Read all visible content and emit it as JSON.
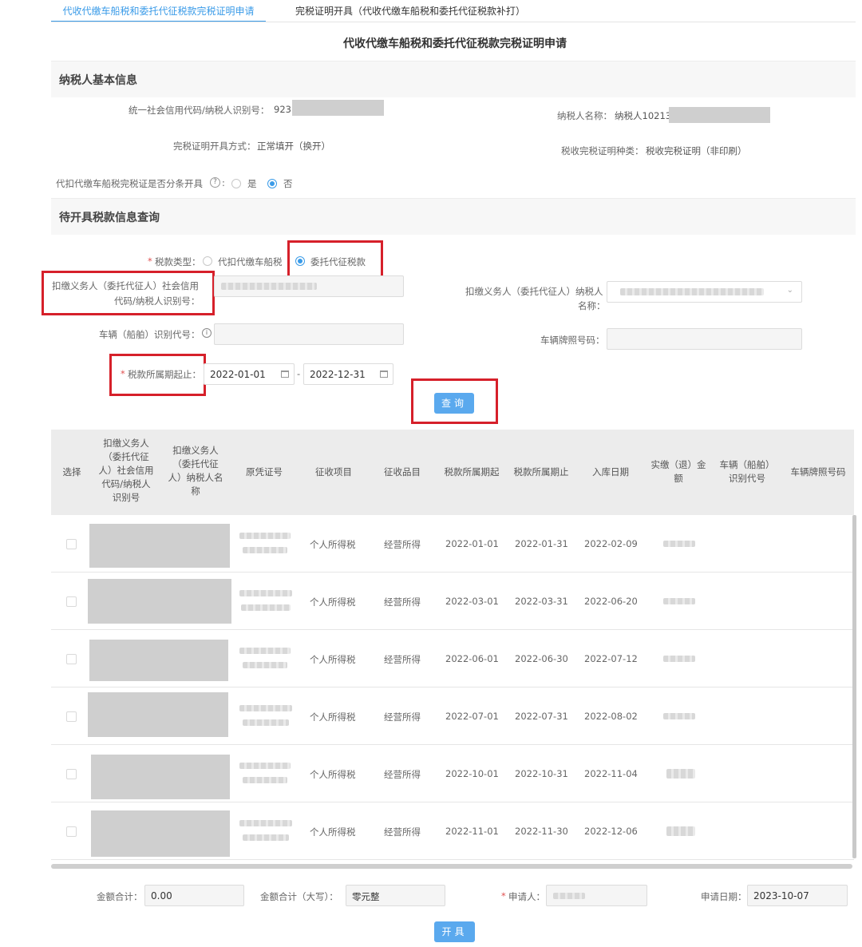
{
  "tabs": [
    {
      "label": "代收代缴车船税和委托代征税款完税证明申请"
    },
    {
      "label": "完税证明开具（代收代缴车船税和委托代征税款补打）"
    }
  ],
  "page_title": "代收代缴车船税和委托代征税款完税证明申请",
  "taxpayer_section": {
    "title": "纳税人基本信息",
    "credit_code_label": "统一社会信用代码/纳税人识别号：",
    "credit_code_value": "923",
    "name_label": "纳税人名称：",
    "name_value": "纳税人10213",
    "issue_method_label": "完税证明开具方式：",
    "issue_method_value": "正常填开（换开）",
    "cert_type_label": "税收完税证明种类：",
    "cert_type_value": "税收完税证明（非印刷）",
    "split_label": "代扣代缴车船税完税证是否分条开具",
    "split_help": "?",
    "split_yes": "是",
    "split_no": "否"
  },
  "query_section": {
    "title": "待开具税款信息查询",
    "tax_type_label": "税款类型：",
    "tax_type_option1": "代扣代缴车船税",
    "tax_type_option2": "委托代征税款",
    "withholder_code_label_line1": "扣缴义务人（委托代征人）社会信用",
    "withholder_code_label_line2": "代码/纳税人识别号：",
    "withholder_name_label_line1": "扣缴义务人（委托代征人）纳税人",
    "withholder_name_label_line2": "名称：",
    "vehicle_id_label": "车辆（船舶）识别代号：",
    "vehicle_id_info": "i",
    "plate_label": "车辆牌照号码：",
    "period_label": "税款所属期起止：",
    "period_start": "2022-01-01",
    "period_end": "2022-12-31",
    "period_sep": "-",
    "query_button": "查询"
  },
  "table": {
    "headers": [
      {
        "label": "选择"
      },
      {
        "label": "扣缴义务人（委托代征人）社会信用代码/纳税人识别号"
      },
      {
        "label": "扣缴义务人（委托代征人）纳税人名称"
      },
      {
        "label": "原凭证号"
      },
      {
        "label": "征收项目"
      },
      {
        "label": "征收品目"
      },
      {
        "label": "税款所属期起"
      },
      {
        "label": "税款所属期止"
      },
      {
        "label": "入库日期"
      },
      {
        "label": "实缴（退）金额"
      },
      {
        "label": "车辆（船舶）识别代号"
      },
      {
        "label": "车辆牌照号码"
      }
    ],
    "rows": [
      {
        "item": "个人所得税",
        "category": "经营所得",
        "start": "2022-01-01",
        "end": "2022-01-31",
        "date": "2022-02-09"
      },
      {
        "item": "个人所得税",
        "category": "经营所得",
        "start": "2022-03-01",
        "end": "2022-03-31",
        "date": "2022-06-20"
      },
      {
        "item": "个人所得税",
        "category": "经营所得",
        "start": "2022-06-01",
        "end": "2022-06-30",
        "date": "2022-07-12"
      },
      {
        "item": "个人所得税",
        "category": "经营所得",
        "start": "2022-07-01",
        "end": "2022-07-31",
        "date": "2022-08-02"
      },
      {
        "item": "个人所得税",
        "category": "经营所得",
        "start": "2022-10-01",
        "end": "2022-10-31",
        "date": "2022-11-04"
      },
      {
        "item": "个人所得税",
        "category": "经营所得",
        "start": "2022-11-01",
        "end": "2022-11-30",
        "date": "2022-12-06"
      }
    ]
  },
  "footer": {
    "total_label": "金额合计：",
    "total_value": "0.00",
    "total_upper_label": "金额合计（大写）：",
    "total_upper_value": "零元整",
    "applicant_label": "申请人：",
    "date_label": "申请日期：",
    "date_value": "2023-10-07",
    "issue_button": "开具"
  },
  "required_mark": "*",
  "colors": {
    "accent": "#3a9be8",
    "highlight": "#d6202a",
    "button": "#5aa9ee"
  }
}
